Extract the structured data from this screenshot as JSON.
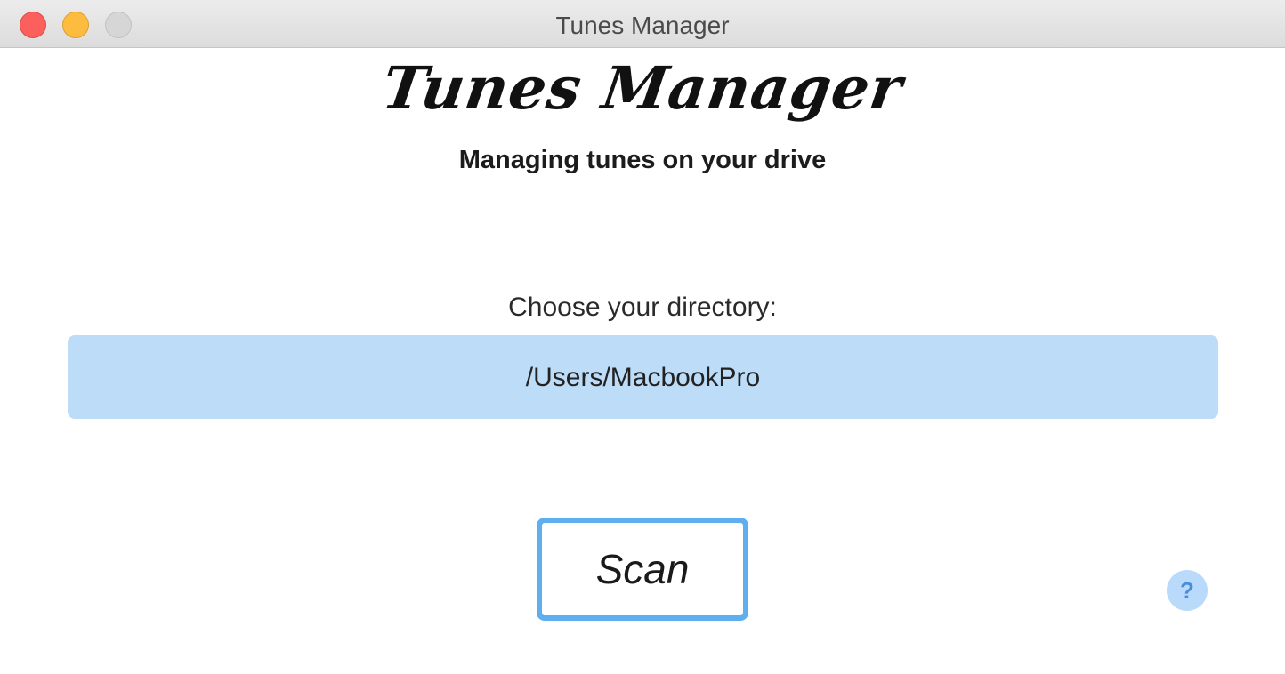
{
  "window": {
    "title": "Tunes Manager"
  },
  "header": {
    "brand": "Tunes Manager",
    "tagline": "Managing tunes on your drive"
  },
  "directory": {
    "label": "Choose your directory:",
    "value": "/Users/MacbookPro"
  },
  "actions": {
    "scan_label": "Scan",
    "help_label": "?"
  },
  "icons": {
    "close": "close-traffic-light",
    "minimize": "minimize-traffic-light",
    "zoom": "zoom-traffic-light",
    "help": "question-mark-icon"
  },
  "colors": {
    "close": "#fc605c",
    "minimize": "#fdbc40",
    "zoom_disabled": "#d6d6d6",
    "field_background": "#bcdcf8",
    "accent": "#5eaef0",
    "help_background": "#b9dafa"
  }
}
